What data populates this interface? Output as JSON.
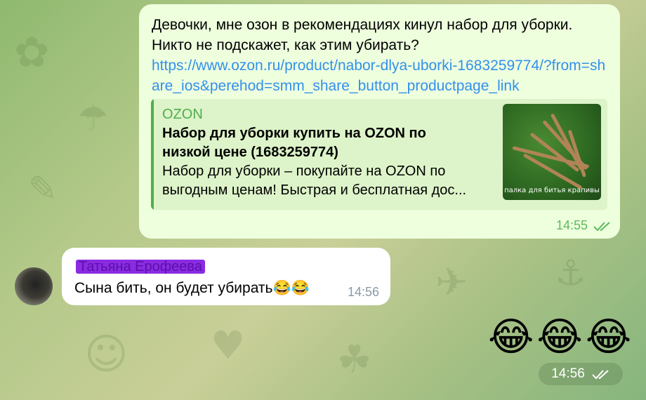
{
  "chat": {
    "outgoing": {
      "line1": "Девочки, мне озон в рекомендациях кинул набор для уборки.",
      "line2": "Никто не подскажет, как этим убирать?",
      "link": "https://www.ozon.ru/product/nabor-dlya-uborki-1683259774/?from=share_ios&perehod=smm_share_button_productpage_link",
      "preview": {
        "site": "OZON",
        "title": "Набор для уборки купить на OZON по низкой цене (1683259774)",
        "description": "Набор для уборки – покупайте на OZON по выгодным ценам! Быстрая и бесплатная дос...",
        "image_caption": "палка для битья крапивы"
      },
      "time": "14:55",
      "status_icon": "double-check-icon"
    },
    "incoming": {
      "sender": "Татьяна Ерофеева",
      "text": "Сына бить, он будет убирать😂😂",
      "time": "14:56"
    },
    "emoji_message": {
      "emojis": "😂😂😂",
      "time": "14:56",
      "status_icon": "double-check-icon"
    }
  },
  "colors": {
    "outgoing_bubble": "#eeffde",
    "link": "#3390ec",
    "preview_accent": "#4fae4e",
    "sender_highlight": "#8a2be2"
  }
}
